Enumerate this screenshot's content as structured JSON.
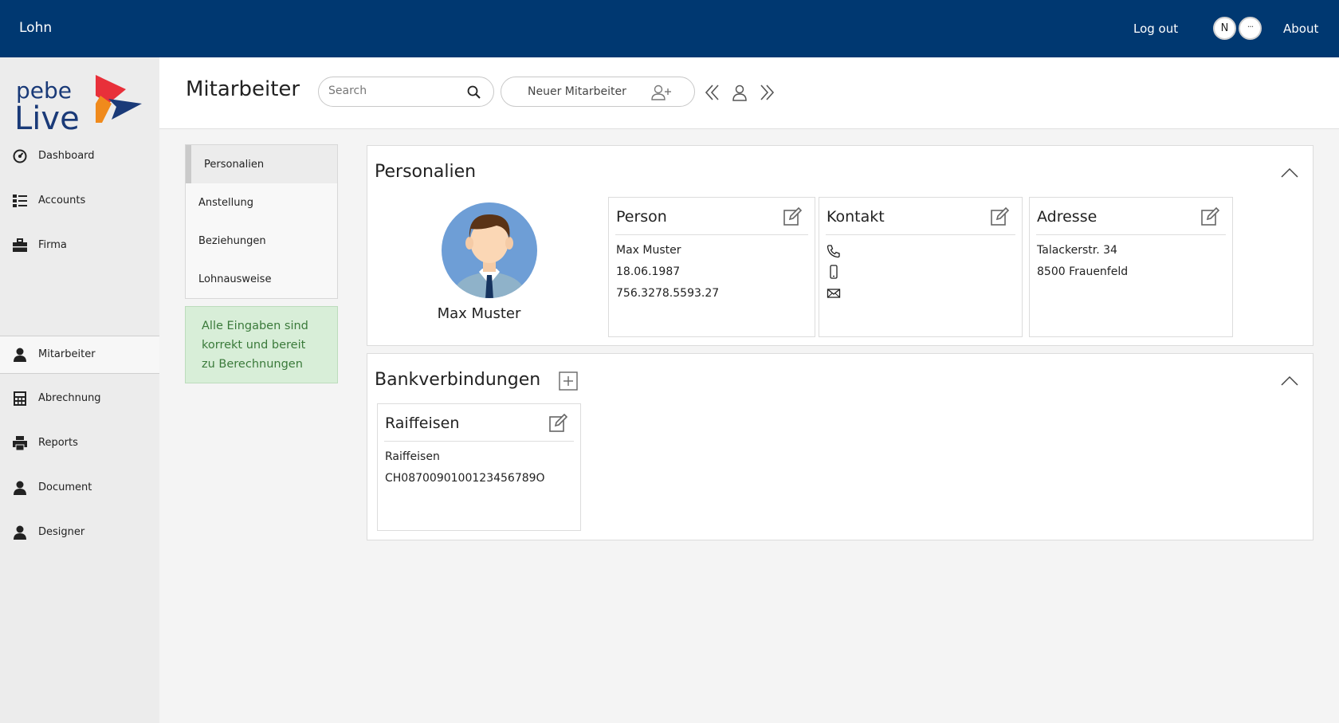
{
  "topbar": {
    "app_title": "Lohn",
    "logout_label": "Log out",
    "user_initial": "N",
    "more_label": "···",
    "about_label": "About"
  },
  "logo": {
    "line1": "pebe",
    "line2": "Live"
  },
  "sidebar": {
    "items": [
      {
        "label": "Dashboard",
        "icon": "dashboard-icon"
      },
      {
        "label": "Accounts",
        "icon": "list-icon"
      },
      {
        "label": "Firma",
        "icon": "briefcase-icon"
      },
      {
        "label": "Mitarbeiter",
        "icon": "person-icon"
      },
      {
        "label": "Abrechnung",
        "icon": "calculator-icon"
      },
      {
        "label": "Reports",
        "icon": "printer-icon"
      },
      {
        "label": "Document",
        "icon": "person-icon"
      },
      {
        "label": "Designer",
        "icon": "person-icon"
      }
    ],
    "active": "Mitarbeiter"
  },
  "header": {
    "title": "Mitarbeiter",
    "search_placeholder": "Search",
    "new_employee_label": "Neuer Mitarbeiter"
  },
  "subnav": {
    "items": [
      "Personalien",
      "Anstellung",
      "Beziehungen",
      "Lohnausweise"
    ],
    "active": "Personalien"
  },
  "status": {
    "text": "Alle Eingaben sind korrekt und bereit zu Berechnungen"
  },
  "personalien": {
    "title": "Personalien",
    "employee_name": "Max Muster",
    "person": {
      "title": "Person",
      "name": "Max Muster",
      "birthdate": "18.06.1987",
      "ahv_number": "756.3278.5593.27"
    },
    "kontakt": {
      "title": "Kontakt"
    },
    "adresse": {
      "title": "Adresse",
      "street": "Talackerstr. 34",
      "city": "8500 Frauenfeld"
    }
  },
  "bank": {
    "title": "Bankverbindungen",
    "accounts": [
      {
        "title": "Raiffeisen",
        "bank_name": "Raiffeisen",
        "iban": "CH0870090100123456789O"
      }
    ]
  },
  "colors": {
    "topbar": "#003871",
    "status_bg": "#d8eed8",
    "status_text": "#3a7a3a",
    "logo_red": "#e8303a",
    "logo_orange": "#f08a1c",
    "logo_navy": "#1a3a78"
  }
}
